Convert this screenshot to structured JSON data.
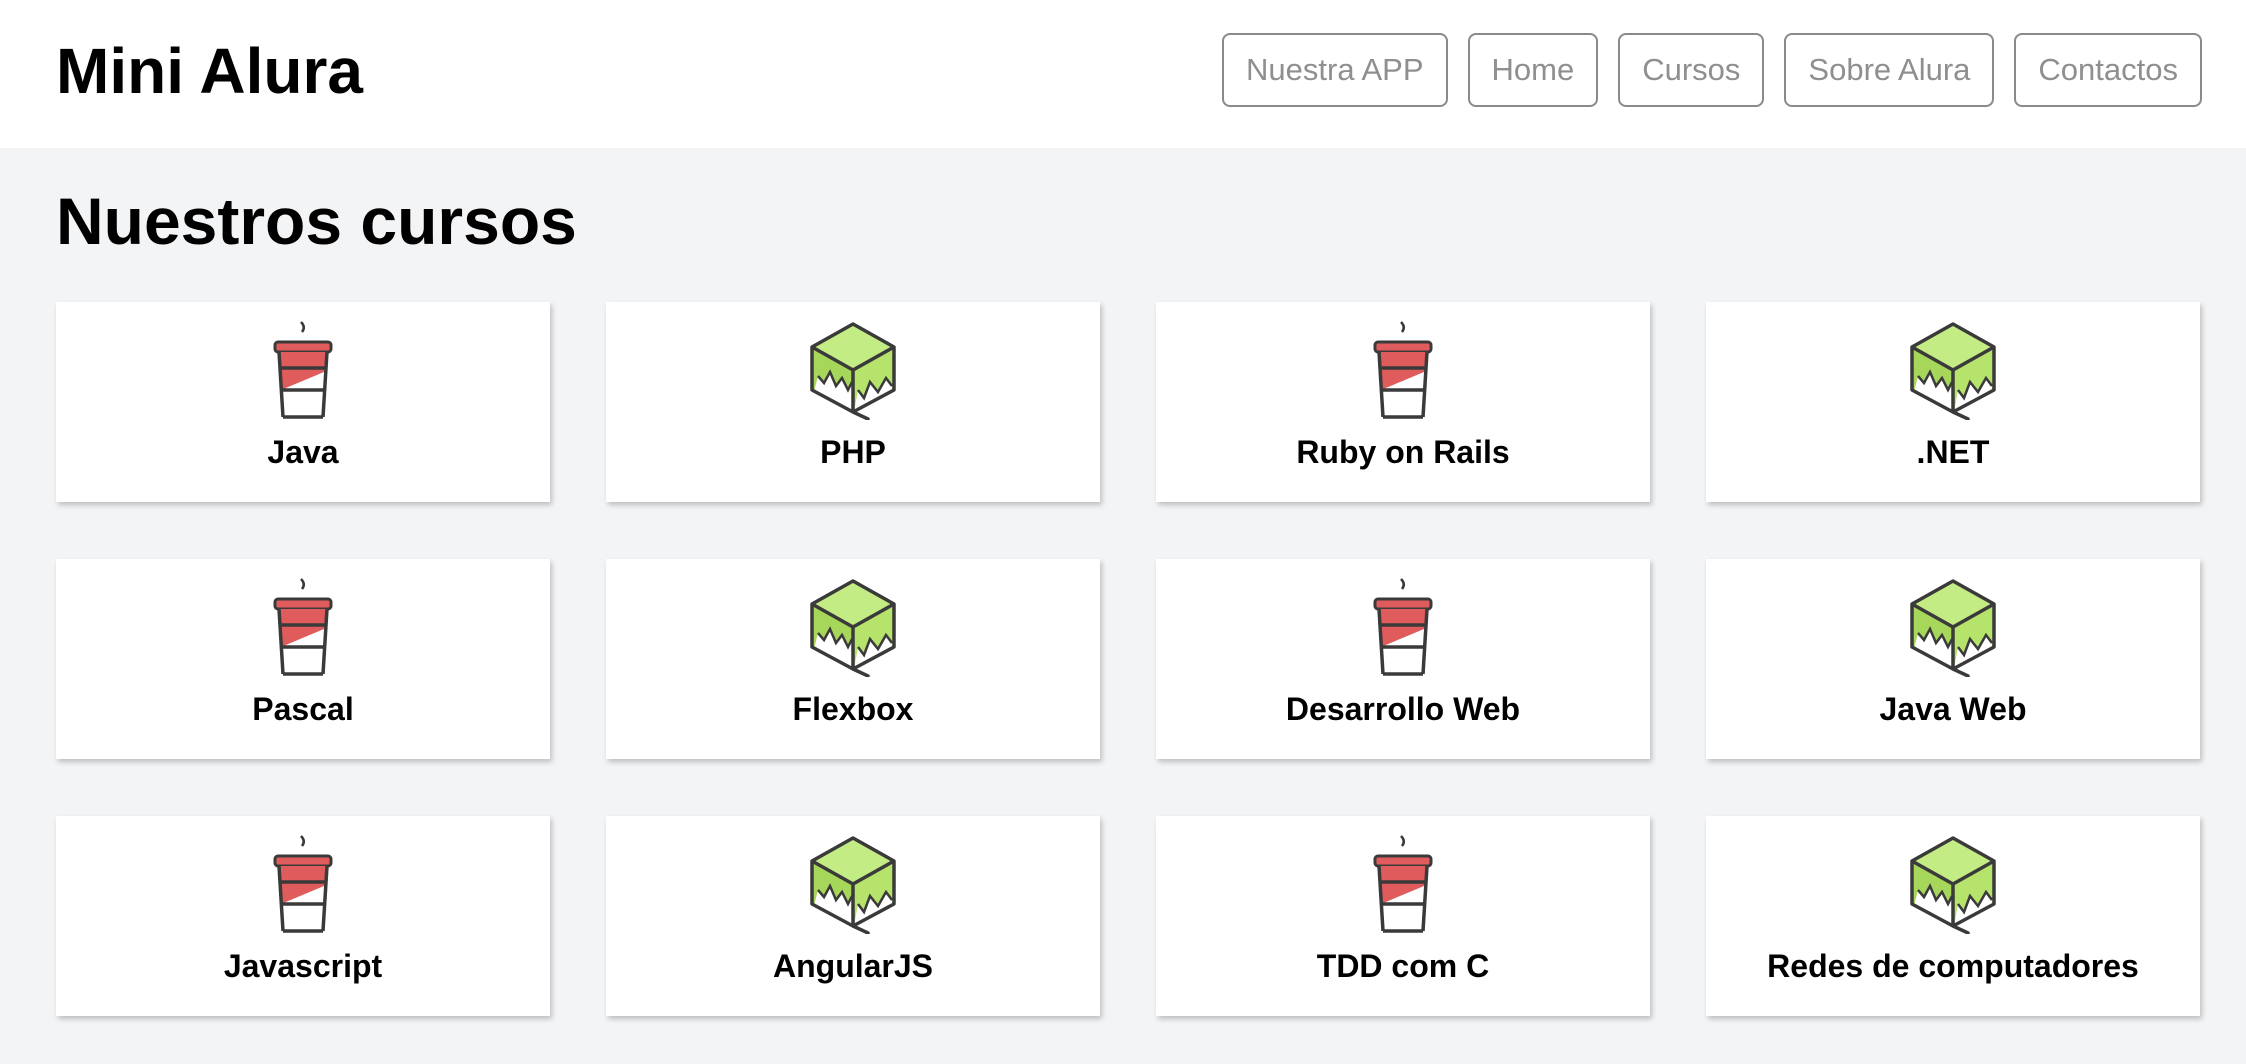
{
  "header": {
    "brand": "Mini Alura",
    "nav": [
      "Nuestra APP",
      "Home",
      "Cursos",
      "Sobre Alura",
      "Contactos"
    ]
  },
  "main": {
    "title": "Nuestros cursos",
    "courses": [
      {
        "name": "Java",
        "icon": "coffee-cup-icon"
      },
      {
        "name": "PHP",
        "icon": "green-cube-icon"
      },
      {
        "name": "Ruby on Rails",
        "icon": "coffee-cup-icon"
      },
      {
        "name": ".NET",
        "icon": "green-cube-icon"
      },
      {
        "name": "Pascal",
        "icon": "coffee-cup-icon"
      },
      {
        "name": "Flexbox",
        "icon": "green-cube-icon"
      },
      {
        "name": "Desarrollo Web",
        "icon": "coffee-cup-icon"
      },
      {
        "name": "Java Web",
        "icon": "green-cube-icon"
      },
      {
        "name": "Javascript",
        "icon": "coffee-cup-icon"
      },
      {
        "name": "AngularJS",
        "icon": "green-cube-icon"
      },
      {
        "name": "TDD com C",
        "icon": "coffee-cup-icon"
      },
      {
        "name": "Redes de computadores",
        "icon": "green-cube-icon"
      }
    ]
  },
  "colors": {
    "background": "#f3f4f6",
    "cup_red": "#e05c5c",
    "cube_green": "#b5e36b",
    "outline": "#3a3a3a",
    "nav_text": "#8f8f8f"
  }
}
